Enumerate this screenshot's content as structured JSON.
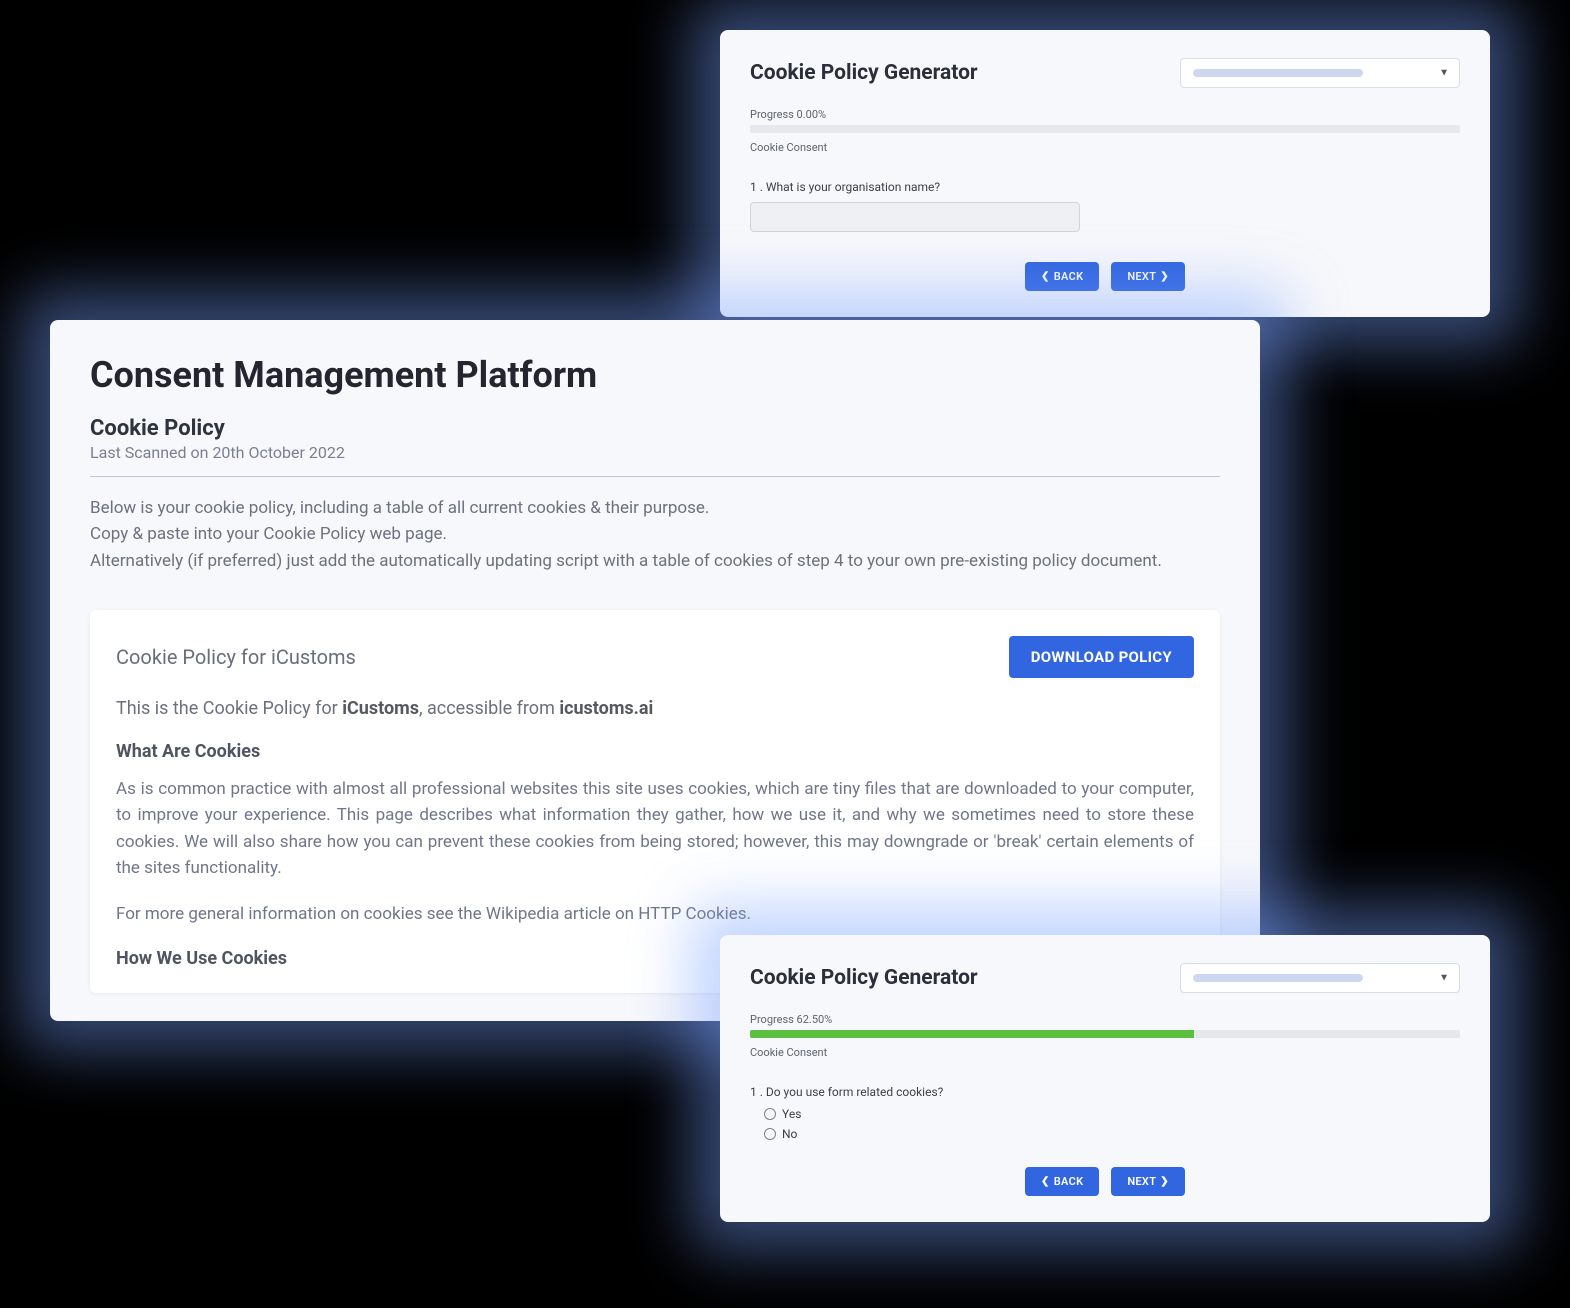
{
  "generator1": {
    "title": "Cookie Policy Generator",
    "progress_label": "Progress 0.00%",
    "progress_pct": 0,
    "sub_label": "Cookie Consent",
    "question": "1 . What is your organisation name?",
    "back_label": "BACK",
    "next_label": "NEXT"
  },
  "main": {
    "title": "Consent Management Platform",
    "subtitle": "Cookie Policy",
    "scanned": "Last Scanned on 20th October 2022",
    "intro1": "Below is your cookie policy, including a table of all current cookies & their purpose.",
    "intro2": "Copy & paste into your Cookie Policy web page.",
    "intro3": "Alternatively (if preferred) just add the automatically updating script with a table of cookies of step 4 to your own pre-existing policy document.",
    "card": {
      "header": "Cookie Policy for iCustoms",
      "download": "DOWNLOAD POLICY",
      "for_prefix": "This is the Cookie Policy for ",
      "for_company": "iCustoms",
      "for_mid": ", accessible from ",
      "for_domain": "icustoms.ai",
      "h1": "What Are Cookies",
      "p1": "As is common practice with almost all professional websites this site uses cookies, which are tiny files that are downloaded to your computer, to improve your experience. This page describes what information they gather, how we use it, and why we sometimes need to store these cookies. We will also share how you can prevent these cookies from being stored; however, this may downgrade or 'break' certain elements of the sites functionality.",
      "p2": "For more general information on cookies see the Wikipedia article on HTTP Cookies.",
      "h2": "How We Use Cookies"
    }
  },
  "generator2": {
    "title": "Cookie Policy Generator",
    "progress_label": "Progress 62.50%",
    "progress_pct": 62.5,
    "sub_label": "Cookie Consent",
    "question": "1 . Do you use form related cookies?",
    "option_yes": "Yes",
    "option_no": "No",
    "back_label": "BACK",
    "next_label": "NEXT"
  }
}
